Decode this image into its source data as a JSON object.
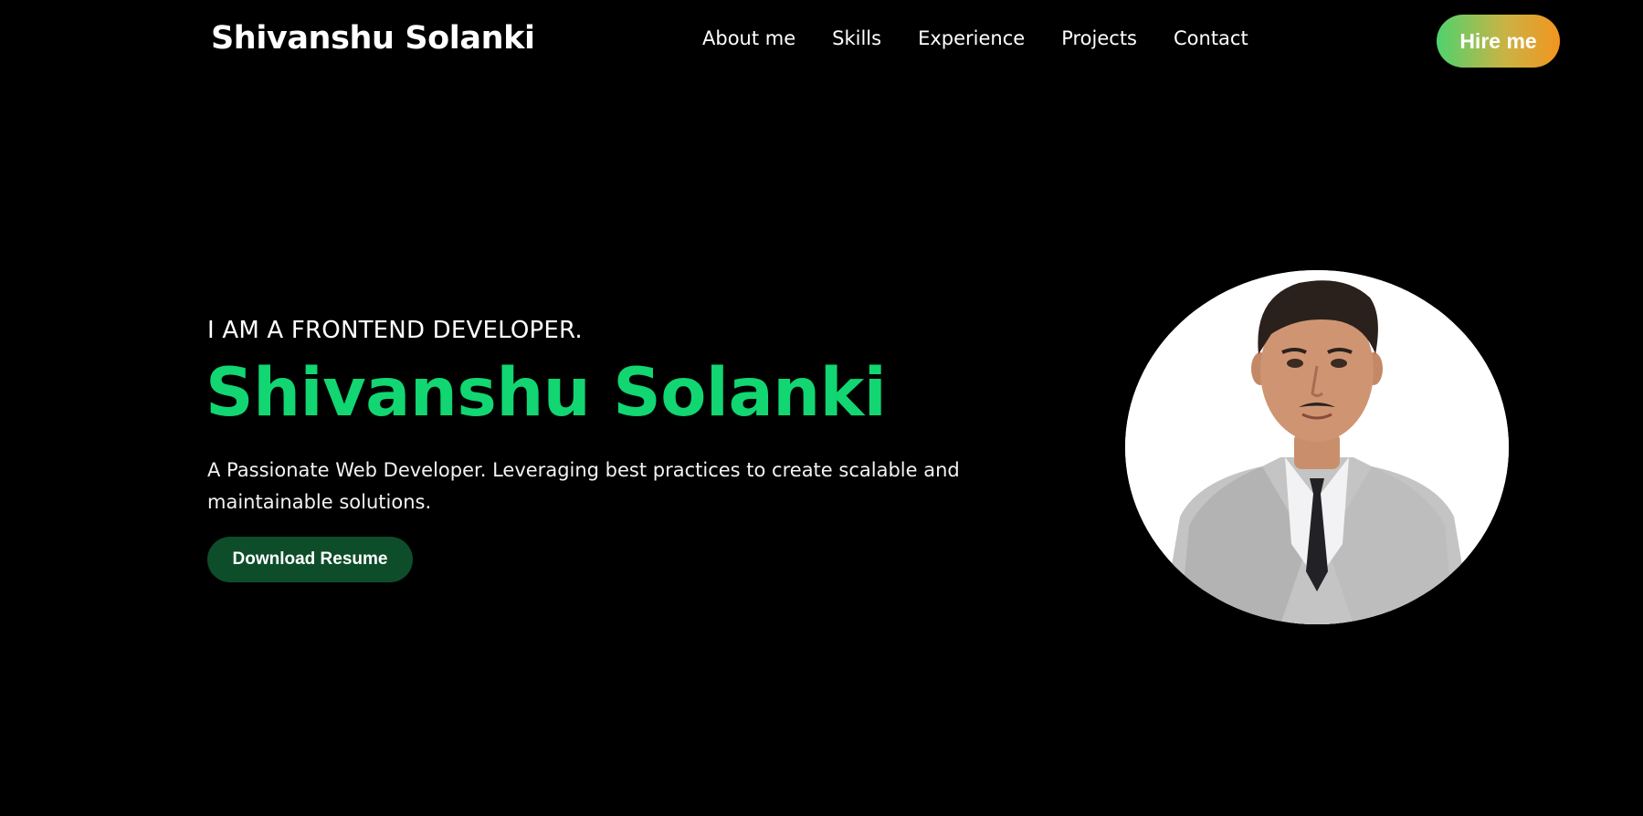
{
  "header": {
    "brand": "Shivanshu Solanki",
    "nav": [
      "About me",
      "Skills",
      "Experience",
      "Projects",
      "Contact"
    ],
    "hire_label": "Hire me"
  },
  "hero": {
    "eyebrow": "I AM A FRONTEND DEVELOPER.",
    "name": "Shivanshu Solanki",
    "description": "A Passionate Web Developer. Leveraging best practices to create scalable and maintainable solutions.",
    "download_label": "Download Resume"
  },
  "colors": {
    "background": "#000000",
    "accent_green": "#11d672",
    "button_dark_green": "#0e4d2a",
    "hire_gradient_start": "#4fd26d",
    "hire_gradient_end": "#f2951f"
  },
  "images": {
    "portrait": "profile-photo"
  }
}
